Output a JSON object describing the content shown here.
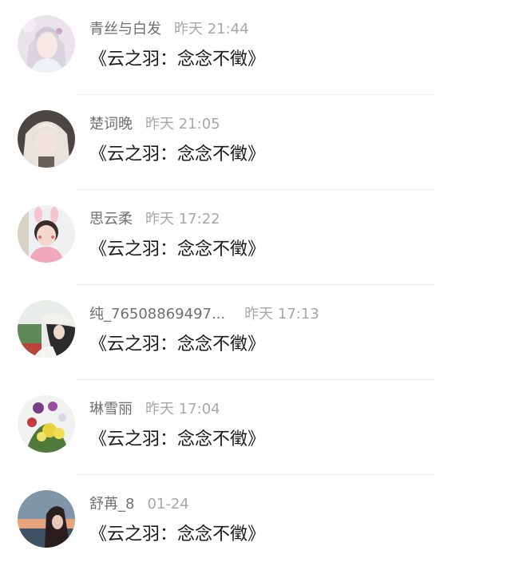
{
  "comments": [
    {
      "name": "青丝与白发",
      "time": "昨天 21:44",
      "message": "《云之羽：念念不徵》",
      "avatar": "avatar-anime-girl"
    },
    {
      "name": "楚词晚",
      "time": "昨天 21:05",
      "message": "《云之羽：念念不徵》",
      "avatar": "avatar-blonde-portrait"
    },
    {
      "name": "思云柔",
      "time": "昨天 17:22",
      "message": "《云之羽：念念不徵》",
      "avatar": "avatar-girl-bunny-ears"
    },
    {
      "name": "纯_76508869497...",
      "time": "昨天 17:13",
      "message": "《云之羽：念念不徵》",
      "avatar": "avatar-woman-hat"
    },
    {
      "name": "琳雪丽",
      "time": "昨天 17:04",
      "message": "《云之羽：念念不徵》",
      "avatar": "avatar-flowers"
    },
    {
      "name": "舒苒_8",
      "time": "01-24",
      "message": "《云之羽：念念不徵》",
      "avatar": "avatar-woman-sunset"
    }
  ]
}
